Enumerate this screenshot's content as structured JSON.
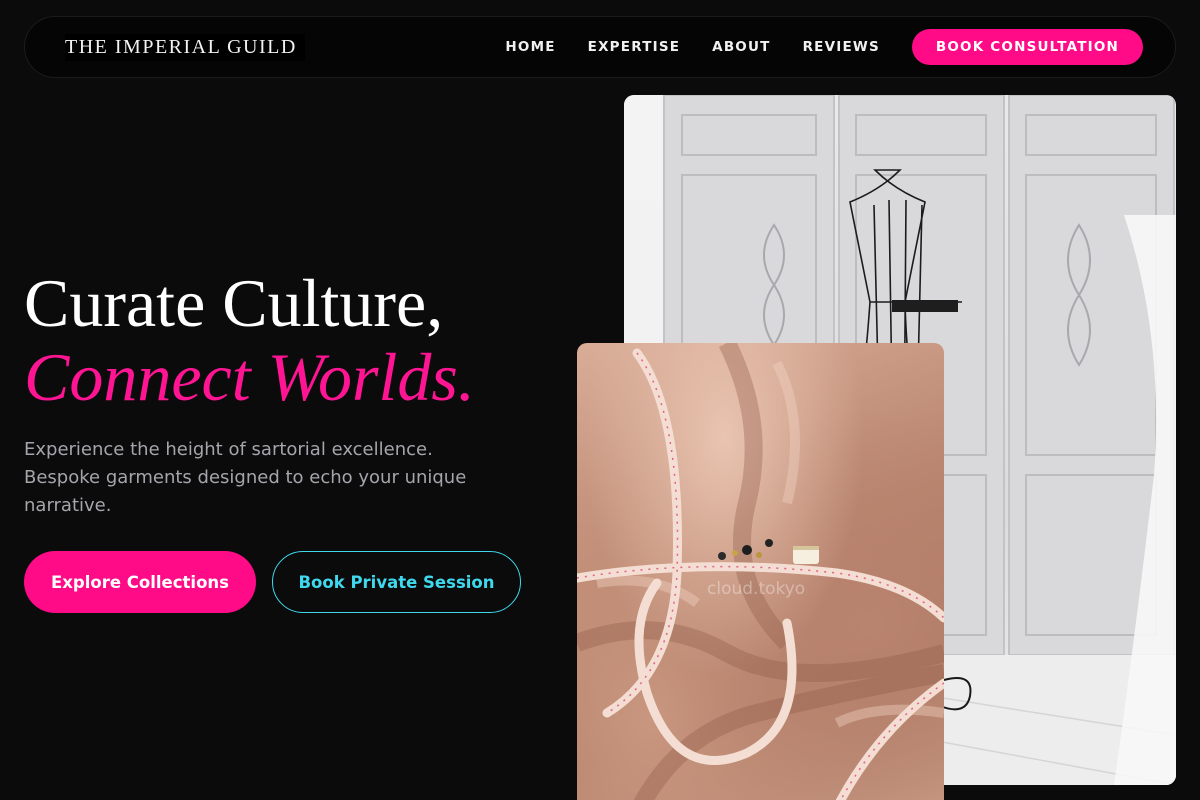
{
  "brand": {
    "name": "THE IMPERIAL GUILD"
  },
  "nav": {
    "links": [
      "HOME",
      "EXPERTISE",
      "ABOUT",
      "REVIEWS"
    ],
    "cta": "BOOK CONSULTATION"
  },
  "hero": {
    "title_line1": "Curate Culture,",
    "title_line2": "Connect Worlds.",
    "subtitle": "Experience the height of sartorial excellence. Bespoke garments designed to echo your unique narrative.",
    "primary_button": "Explore Collections",
    "secondary_button": "Book Private Session"
  },
  "images": {
    "back": {
      "icon": "tailor-mannequin-image"
    },
    "front": {
      "icon": "silk-fabric-tape-measure-image",
      "watermark": "cloud.tokyo"
    }
  },
  "colors": {
    "background": "#0b0b0c",
    "accent_pink": "#ff0a87",
    "accent_cyan": "#3fd9ee",
    "muted_text": "#a5a5ab"
  }
}
